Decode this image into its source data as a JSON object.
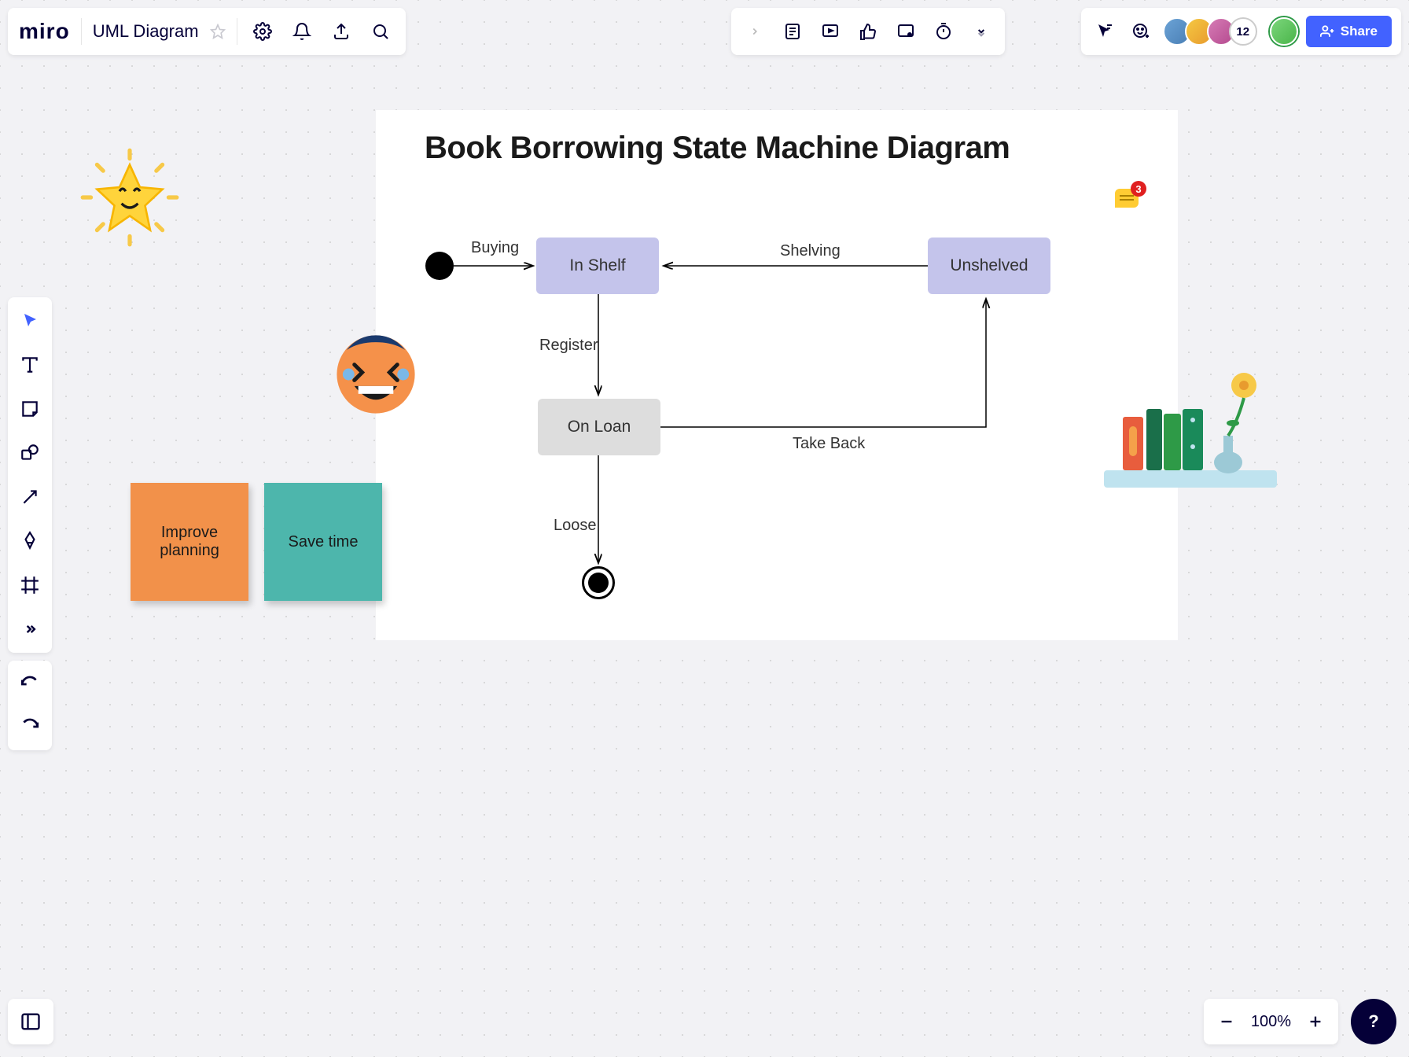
{
  "app": {
    "logo": "miro"
  },
  "board": {
    "title": "UML Diagram"
  },
  "share": {
    "label": "Share"
  },
  "collab": {
    "overflow_count": "12"
  },
  "zoom": {
    "value": "100%"
  },
  "help": {
    "label": "?"
  },
  "frame": {
    "title": "Book Borrowing State Machine Diagram",
    "states": {
      "in_shelf": "In Shelf",
      "unshelved": "Unshelved",
      "on_loan": "On Loan"
    },
    "transitions": {
      "buying": "Buying",
      "shelving": "Shelving",
      "register": "Register",
      "take_back": "Take Back",
      "loose": "Loose"
    }
  },
  "stickies": {
    "orange": "Improve planning",
    "teal": "Save time"
  },
  "comment": {
    "count": "3"
  }
}
